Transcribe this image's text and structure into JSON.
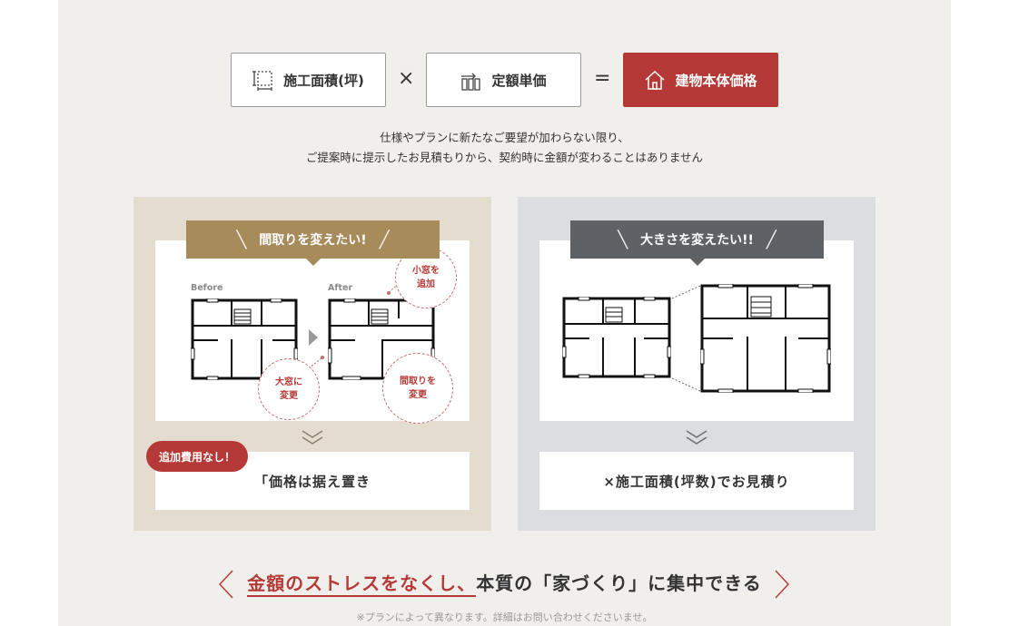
{
  "formula": {
    "area_label": "施工面積(坪)",
    "times": "×",
    "unit_label": "定額単価",
    "equals": "=",
    "result_label": "建物本体価格"
  },
  "subtext": {
    "line1": "仕様やプランに新たなご要望が加わらない限り、",
    "line2": "ご提案時に提示したお見積もりから、契約時に金額が変わることはありません"
  },
  "left_panel": {
    "banner": "間取りを変えたい!",
    "before_label": "Before",
    "after_label": "After",
    "bubble_window": "小窓を\n追加",
    "bubble_big_window": "大窓に\n変更",
    "bubble_layout": "間取りを\n変更",
    "badge": "追加費用なし！",
    "result": "「価格は据え置き"
  },
  "right_panel": {
    "banner": "大きさを変えたい!!",
    "result": "×施工面積(坪数)でお見積り"
  },
  "headline": {
    "highlight": "金額のストレスをなくし、",
    "rest": "本質の「家づくり」に集中できる"
  },
  "note": "※プランによって異なります。詳細はお問い合わせくださいませ。",
  "colors": {
    "accent_red": "#b53a37",
    "brown": "#a78b5b",
    "gray": "#5e6166"
  }
}
